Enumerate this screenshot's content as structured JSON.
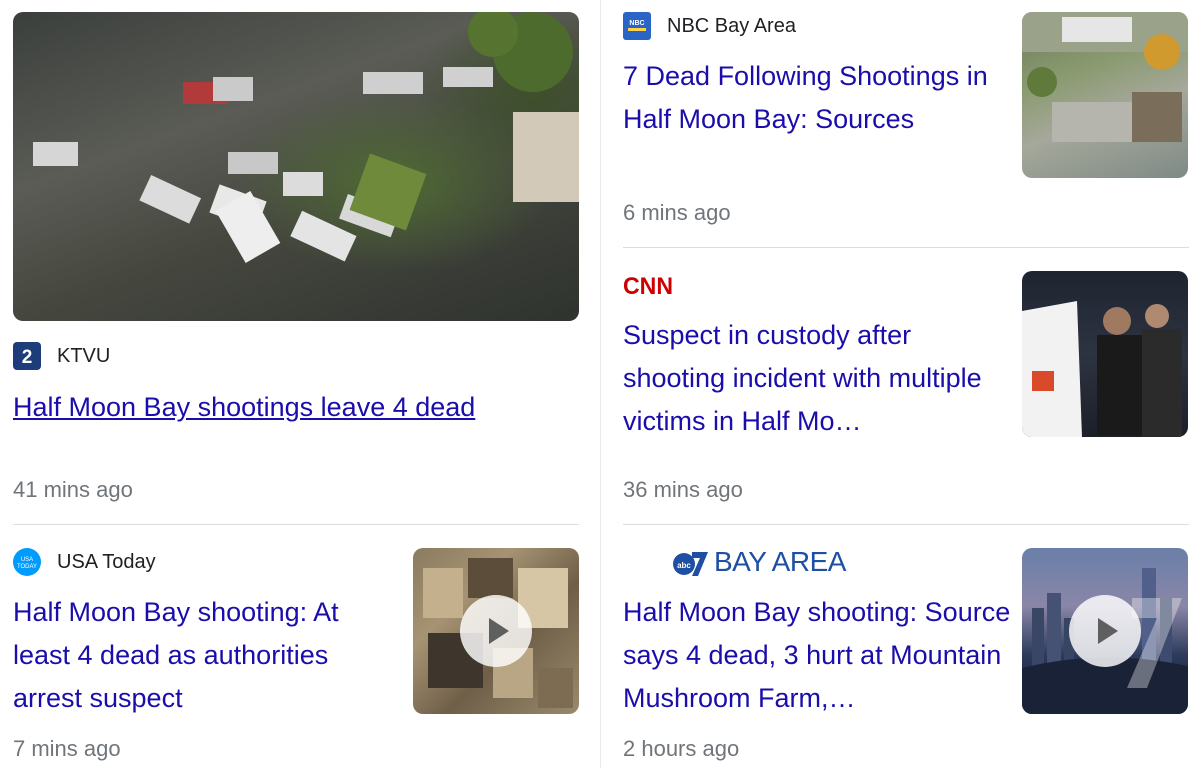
{
  "stories": {
    "ktvu": {
      "source": "KTVU",
      "headline": "Half Moon Bay shootings leave 4 dead",
      "time": "41 mins ago"
    },
    "usatoday": {
      "source": "USA Today",
      "headline": "Half Moon Bay shooting: At least 4 dead as authorities arrest suspect",
      "time": "7 mins ago"
    },
    "nbc": {
      "source": "NBC Bay Area",
      "headline": "7 Dead Following Shootings in Half Moon Bay: Sources",
      "time": "6 mins ago"
    },
    "cnn": {
      "source": "CNN",
      "headline": "Suspect in custody after shooting incident with multiple victims in Half Mo…",
      "time": "36 mins ago"
    },
    "abc7": {
      "source": "BAY AREA",
      "headline": "Half Moon Bay shooting: Source says 4 dead, 3 hurt at Mountain Mushroom Farm,…",
      "time": "2 hours ago"
    }
  },
  "icons": {
    "ktvu_logo": "ktvu-logo-icon",
    "usatoday_logo": "usa-today-logo-icon",
    "nbc_logo": "nbc-logo-icon",
    "cnn_logo": "cnn-logo-icon",
    "abc7_logo": "abc7-logo-icon",
    "play": "play-icon"
  },
  "colors": {
    "link": "#1a0dab",
    "meta": "#70757a",
    "divider": "#dadce0"
  }
}
